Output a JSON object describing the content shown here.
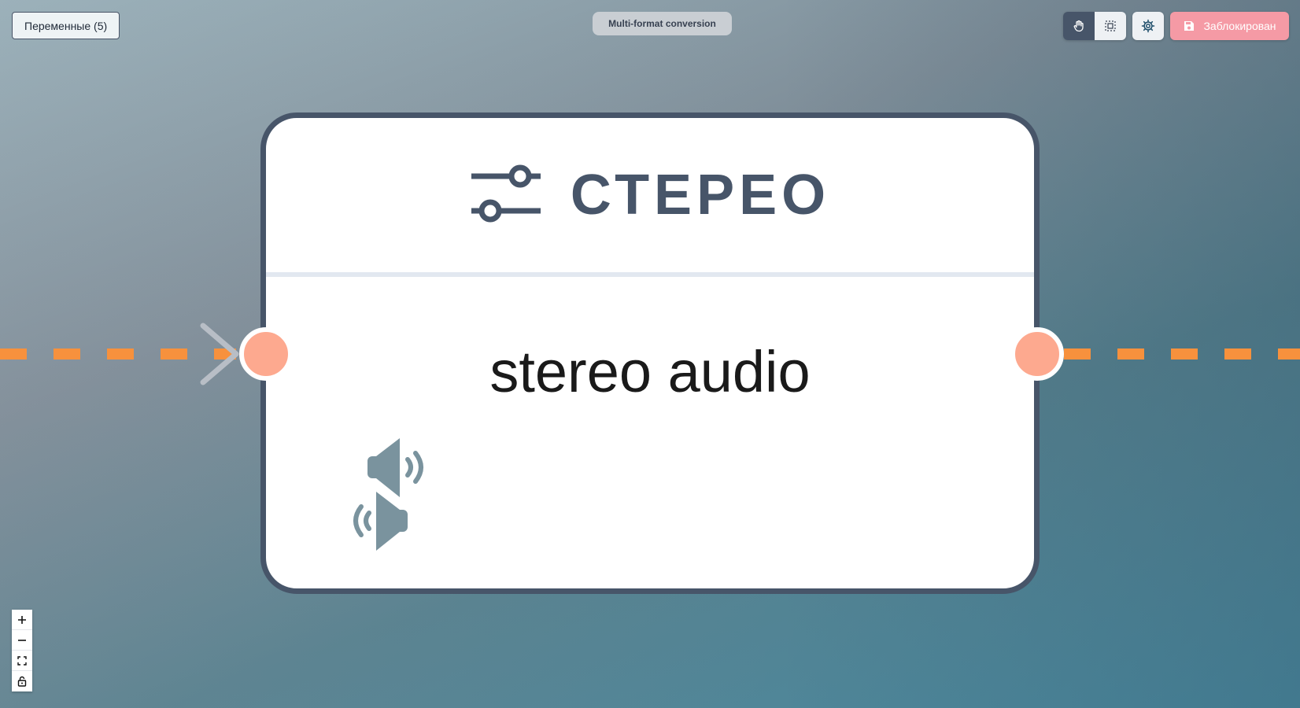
{
  "toolbar": {
    "variables_label": "Переменные (5)",
    "flow_title": "Multi-format conversion",
    "locked_label": "Заблокирован",
    "pan_icon": "hand-icon",
    "select_icon": "select-box-icon",
    "settings_icon": "gear-icon",
    "save_icon": "floppy-disk-icon"
  },
  "node": {
    "title": "СТЕРЕО",
    "label": "stereo audio",
    "header_icon": "sliders-icon",
    "body_icon": "stereo-speakers-icon"
  },
  "zoom_controls": {
    "zoom_in": "zoom-in-icon",
    "zoom_out": "zoom-out-icon",
    "fit_view": "fit-view-icon",
    "lock": "unlock-icon"
  },
  "colors": {
    "edge": "#f7913d",
    "handle": "#fda98f",
    "node_border": "#475569",
    "locked_button": "#f59aa5",
    "active_mode": "#475569"
  }
}
